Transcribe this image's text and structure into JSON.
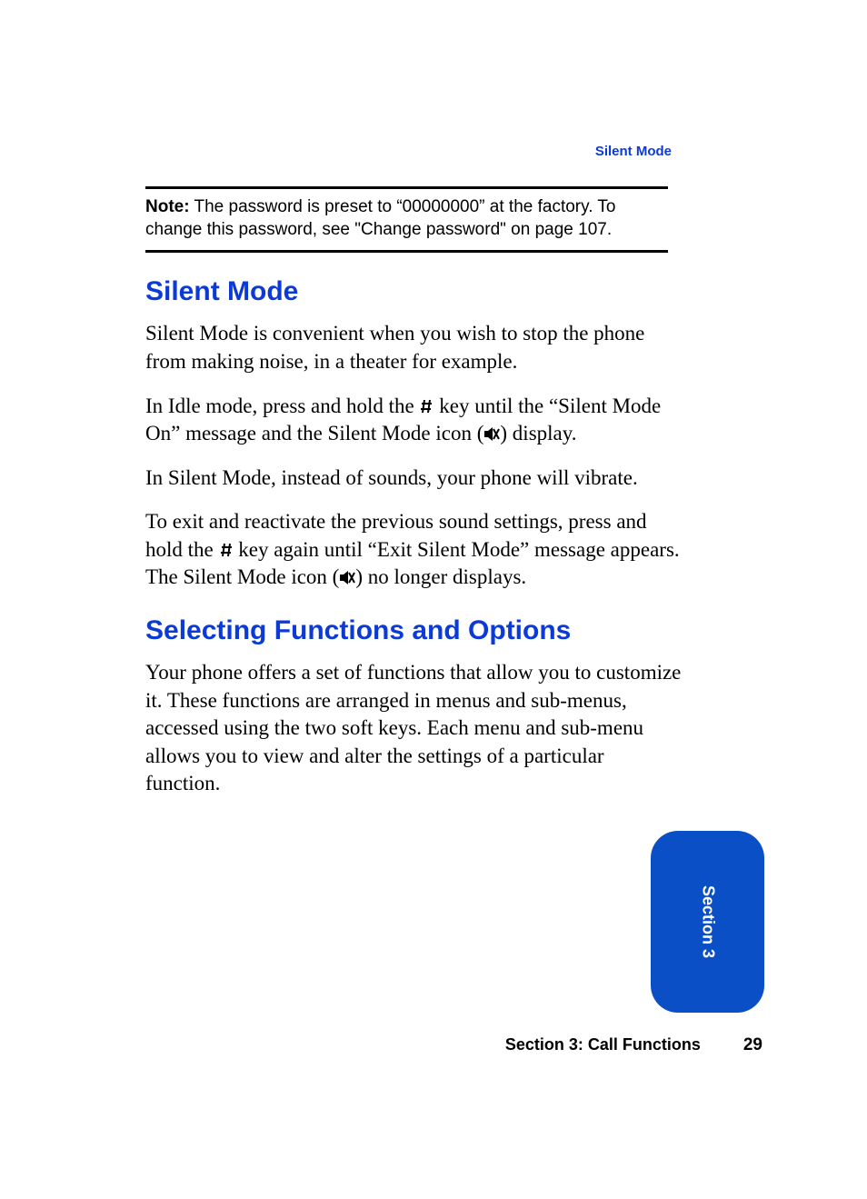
{
  "header": {
    "running_head": "Silent Mode"
  },
  "note": {
    "label": "Note:",
    "text": " The password is preset to “00000000” at the factory. To change this password, see \"Change password\" on page 107."
  },
  "section_silent": {
    "heading": "Silent Mode",
    "p1": "Silent Mode is convenient when you wish to stop the phone from making noise, in a theater for example.",
    "p2a": "In Idle mode, press and hold the ",
    "p2b": " key until the “Silent Mode On” message and the Silent Mode icon (",
    "p2c": ") display.",
    "p3": "In Silent Mode, instead of sounds, your phone will vibrate.",
    "p4a": "To exit and reactivate the previous sound settings, press and hold the ",
    "p4b": " key again until “Exit Silent Mode” message appears. The Silent Mode icon (",
    "p4c": ") no longer displays."
  },
  "section_select": {
    "heading": "Selecting Functions and Options",
    "p1": "Your phone offers a set of functions that allow you to customize it. These functions are arranged in menus and sub-menus, accessed using the two soft keys. Each menu and sub-menu allows you to view and alter the settings of a particular function."
  },
  "side_tab": {
    "label": "Section 3"
  },
  "footer": {
    "section_label": "Section 3: Call Functions",
    "page_number": "29"
  }
}
